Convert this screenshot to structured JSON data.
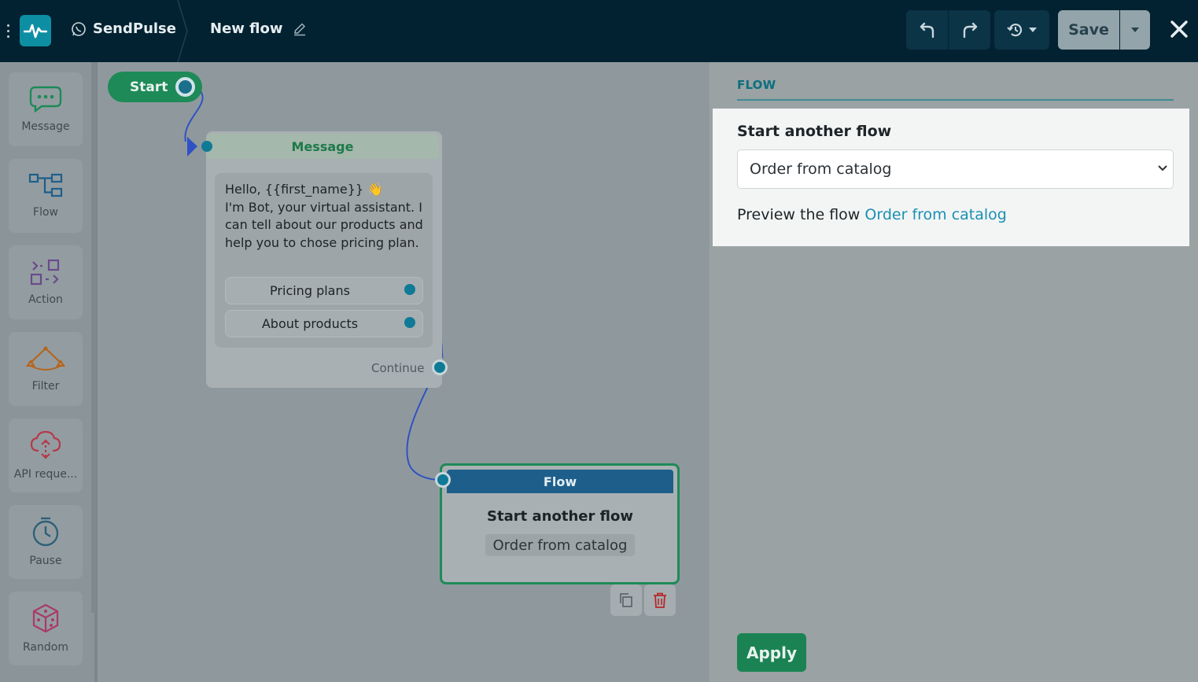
{
  "header": {
    "brand": "SendPulse",
    "flow_title": "New flow",
    "save_label": "Save"
  },
  "palette": {
    "items": [
      {
        "label": "Message",
        "icon": "message-icon",
        "color": "#1e8a58"
      },
      {
        "label": "Flow",
        "icon": "flow-icon",
        "color": "#1d5f8a"
      },
      {
        "label": "Action",
        "icon": "action-icon",
        "color": "#6b4a8c"
      },
      {
        "label": "Filter",
        "icon": "filter-icon",
        "color": "#b5651d"
      },
      {
        "label": "API reque...",
        "icon": "api-request-icon",
        "color": "#b53a4a"
      },
      {
        "label": "Pause",
        "icon": "pause-timer-icon",
        "color": "#2f6078"
      },
      {
        "label": "Random",
        "icon": "random-dice-icon",
        "color": "#a83a6a"
      }
    ]
  },
  "canvas": {
    "start_label": "Start",
    "message_node": {
      "title": "Message",
      "text_line1": "Hello, {{first_name}} 👋",
      "text_rest": "I'm Bot, your virtual assistant. I can tell about our products and help you to chose pricing plan.",
      "buttons": [
        "Pricing plans",
        "About products"
      ],
      "continue_label": "Continue"
    },
    "flow_node": {
      "title": "Flow",
      "action": "Start another flow",
      "target": "Order from catalog"
    }
  },
  "panel": {
    "tab": "FLOW",
    "field_label": "Start another flow",
    "selected_flow": "Order from catalog",
    "preview_prefix": "Preview the flow",
    "preview_link": "Order from catalog",
    "apply_label": "Apply"
  }
}
